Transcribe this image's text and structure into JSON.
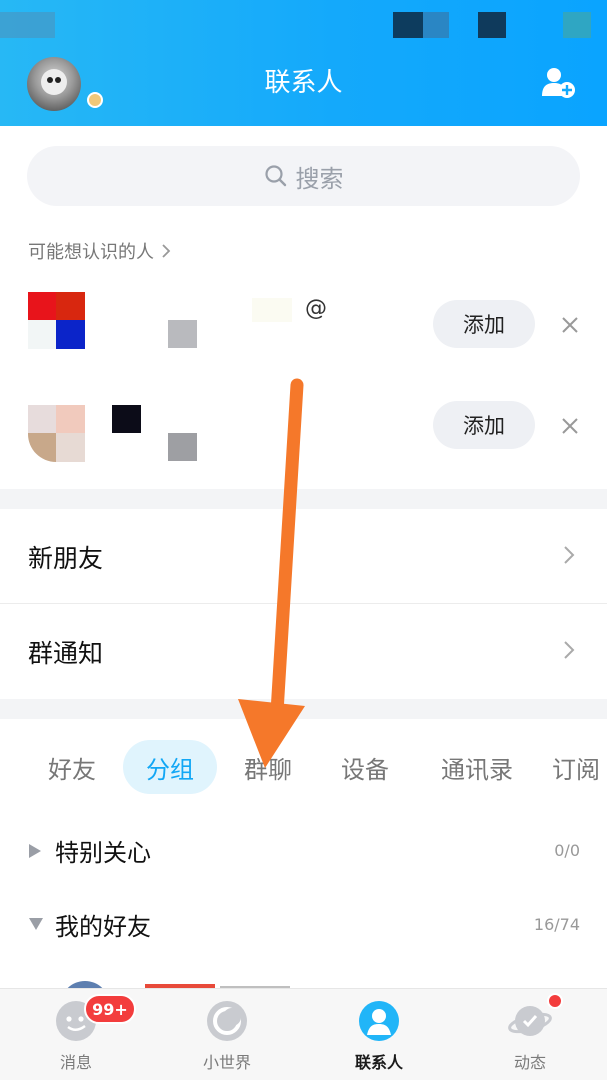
{
  "header": {
    "title": "联系人"
  },
  "search": {
    "placeholder": "搜索"
  },
  "recommend": {
    "section_label": "可能想认识的人",
    "items": [
      {
        "name_fragment": "@",
        "add_label": "添加"
      },
      {
        "add_label": "添加"
      }
    ]
  },
  "nav_rows": [
    {
      "label": "新朋友"
    },
    {
      "label": "群通知"
    }
  ],
  "tabs": [
    {
      "label": "好友",
      "active": false
    },
    {
      "label": "分组",
      "active": true
    },
    {
      "label": "群聊",
      "active": false
    },
    {
      "label": "设备",
      "active": false
    },
    {
      "label": "通讯录",
      "active": false
    },
    {
      "label": "订阅",
      "active": false
    }
  ],
  "groups": [
    {
      "name": "特别关心",
      "count": "0/0",
      "expanded": false
    },
    {
      "name": "我的好友",
      "count": "16/74",
      "expanded": true
    }
  ],
  "bottom_nav": [
    {
      "label": "消息",
      "icon": "message-icon"
    },
    {
      "label": "小世界",
      "icon": "small-world-icon"
    },
    {
      "label": "联系人",
      "icon": "contacts-icon",
      "active": true
    },
    {
      "label": "动态",
      "icon": "planet-icon"
    }
  ],
  "badge": {
    "messages": "99+"
  },
  "colors": {
    "accent": "#12a7f5",
    "header": "#14a9fb",
    "badge": "#f33d3d",
    "annotation_arrow": "#f5782a"
  }
}
